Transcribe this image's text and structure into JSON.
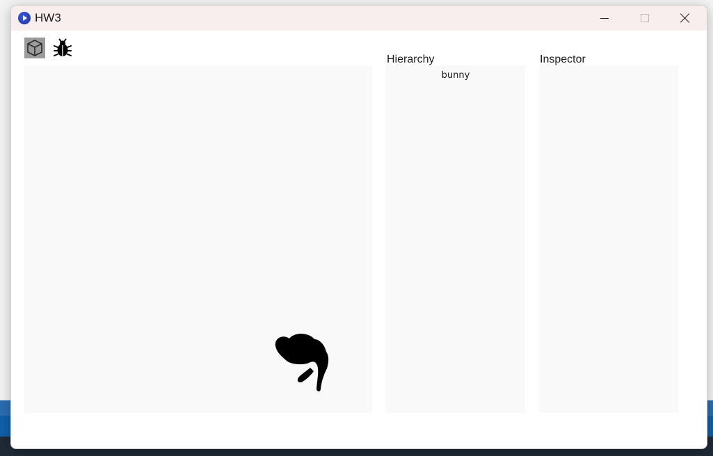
{
  "window": {
    "title": "HW3",
    "app_icon": "app-logo-icon",
    "controls": [
      "minimize-icon",
      "maximize-icon",
      "close-icon"
    ]
  },
  "toolbar": {
    "tools": [
      {
        "icon": "cube-icon",
        "selected": true
      },
      {
        "icon": "bug-icon",
        "selected": false
      }
    ]
  },
  "hierarchy": {
    "heading": "Hierarchy",
    "items": [
      "bunny"
    ]
  },
  "inspector": {
    "heading": "Inspector"
  },
  "scene": {
    "objects": [
      {
        "name": "bunny",
        "icon": "bunny-icon",
        "color": "#000000"
      }
    ]
  },
  "colors": {
    "panel_bg": "#f9f9f9",
    "titlebar_bg": "#f8eeee",
    "selected_tool_bg": "#9b9b9b"
  }
}
